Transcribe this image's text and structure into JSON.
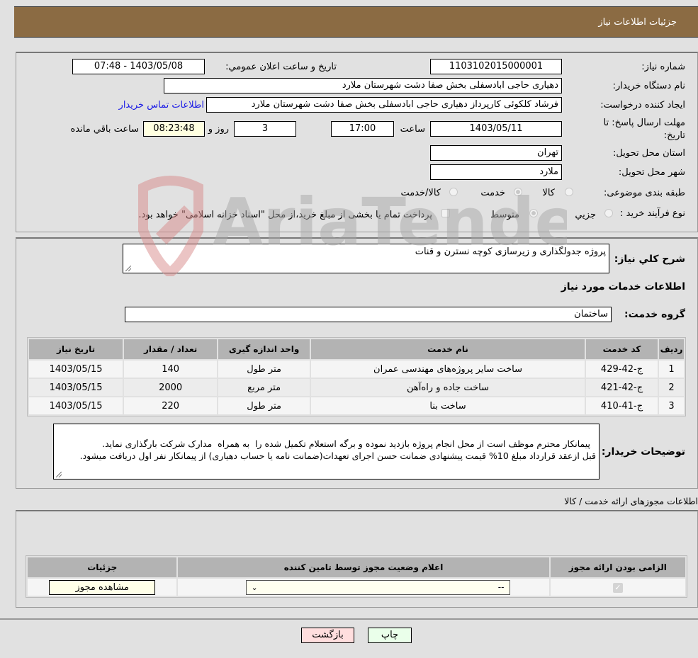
{
  "header": {
    "title": "جزئیات اطلاعات نیاز"
  },
  "info": {
    "need_number_label": "شماره نیاز:",
    "need_number": "1103102015000001",
    "announce_label": "تاريخ و ساعت اعلان عمومي:",
    "announce_value": "1403/05/08 - 07:48",
    "buyer_org_label": "نام دستگاه خريدار:",
    "buyer_org": "دهیاری حاجی ابادسفلی بخش صفا دشت شهرستان ملارد",
    "creator_label": "ايجاد کننده درخواست:",
    "creator": "فرشاد کلکوئی کارپرداز دهیاری حاجی ابادسفلی بخش صفا دشت شهرستان ملارد",
    "contact_link": "اطلاعات تماس خریدار",
    "deadline_label": "مهلت ارسال پاسخ: تا تاریخ:",
    "deadline_date": "1403/05/11",
    "time_label": "ساعت",
    "deadline_time": "17:00",
    "days": "3",
    "days_label": "روز و",
    "remaining_time": "08:23:48",
    "remaining_label": "ساعت باقي مانده",
    "province_label": "استان محل تحویل:",
    "province": "تهران",
    "city_label": "شهر محل تحویل:",
    "city": "ملارد",
    "category_label": "طبقه بندی موضوعی:",
    "category_options": [
      "کالا",
      "خدمت",
      "کالا/خدمت"
    ],
    "category_selected": "خدمت",
    "process_label": "نوع فرآیند خرید :",
    "process_options": [
      "جزيي",
      "متوسط"
    ],
    "process_selected": "متوسط",
    "treasury_note": "پرداخت تمام یا بخشی از مبلغ خرید،از محل \"اسناد خزانه اسلامی\" خواهد بود."
  },
  "details": {
    "description_label": "شرح كلي نياز:",
    "description": "پروژه جدولگذاری و زیرسازی کوچه نسترن و قنات",
    "services_title": "اطلاعات خدمات مورد نياز",
    "service_group_label": "گروه خدمت:",
    "service_group": "ساختمان",
    "table": {
      "headers": [
        "رديف",
        "کد خدمت",
        "نام خدمت",
        "واحد اندازه گیری",
        "تعداد / مقدار",
        "تاریخ نیاز"
      ],
      "rows": [
        [
          "1",
          "ج-42-429",
          "ساخت سایر پروژه‌های مهندسی عمران",
          "متر طول",
          "140",
          "1403/05/15"
        ],
        [
          "2",
          "ج-42-421",
          "ساخت جاده و راه‌آهن",
          "متر مربع",
          "2000",
          "1403/05/15"
        ],
        [
          "3",
          "ج-41-410",
          "ساخت بنا",
          "متر طول",
          "220",
          "1403/05/15"
        ]
      ]
    },
    "buyer_notes_label": "توضیحات خریدار:",
    "buyer_notes": "پیمانکار محترم موظف است از محل انجام پروژه بازدید نموده و برگه استعلام تکمیل شده را  به همراه  مدارک شرکت بارگذاری نماید.\nقبل ازعقد قرارداد مبلغ 10% قیمت پیشنهادی ضمانت حسن اجرای تعهدات(ضمانت نامه یا حساب دهیاری) از پیمانکار نفر اول دریافت میشود."
  },
  "permits": {
    "title": "اطلاعات مجوزهای ارائه خدمت / کالا",
    "headers": [
      "الزامی بودن ارائه مجوز",
      "اعلام وضعیت مجوز توسط تامین کننده",
      "جزئیات"
    ],
    "row": {
      "required_checked": true,
      "status_selected": "--",
      "view_button": "مشاهده مجوز"
    }
  },
  "footer": {
    "print_button": "چاپ",
    "back_button": "بازگشت"
  },
  "watermark": {
    "text": "AriaTender.neT"
  }
}
